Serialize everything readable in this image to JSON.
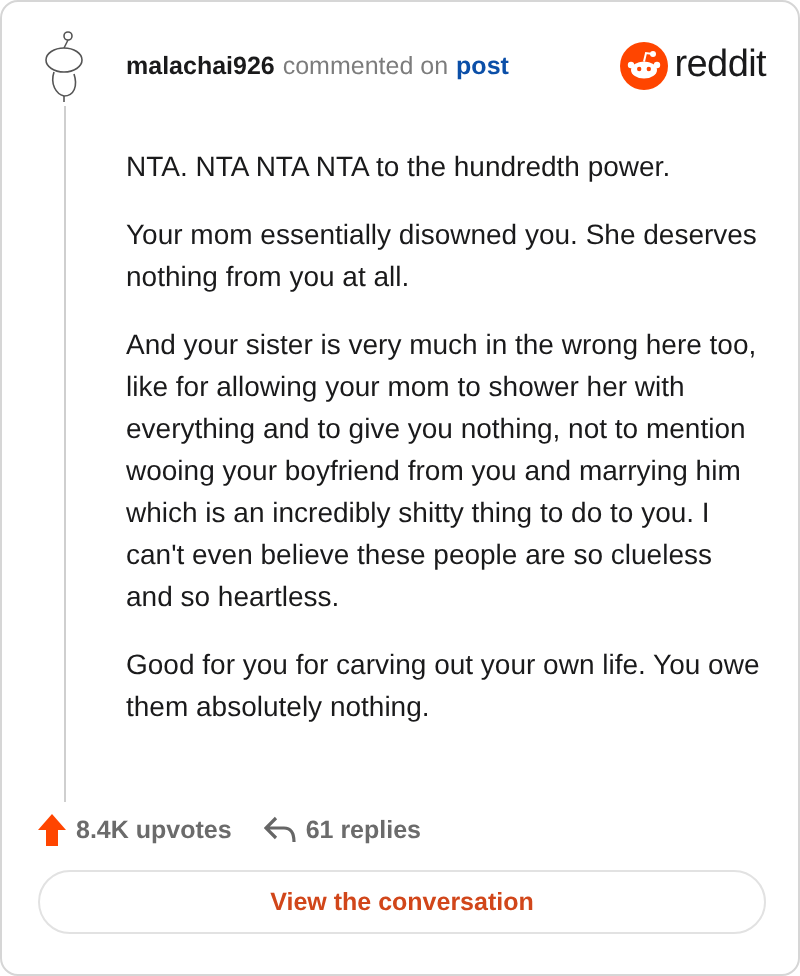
{
  "comment": {
    "author": "malachai926",
    "action": "commented on",
    "link": "post",
    "brand": "reddit",
    "paragraphs": [
      "NTA. NTA NTA NTA to the hundredth power.",
      "Your mom essentially disowned you. She deserves nothing from you at all.",
      "And your sister is very much in the wrong here too, like for allowing your mom to shower her with everything and to give you nothing, not to mention wooing your boyfriend from you and marrying him which is an incredibly shitty thing to do to you. I can't even believe these people are so clueless and so heartless.",
      "Good for you for carving out your own life. You owe them absolutely nothing."
    ]
  },
  "upvotes": "8.4K upvotes",
  "replies": "61 replies",
  "button": "View the conversation"
}
